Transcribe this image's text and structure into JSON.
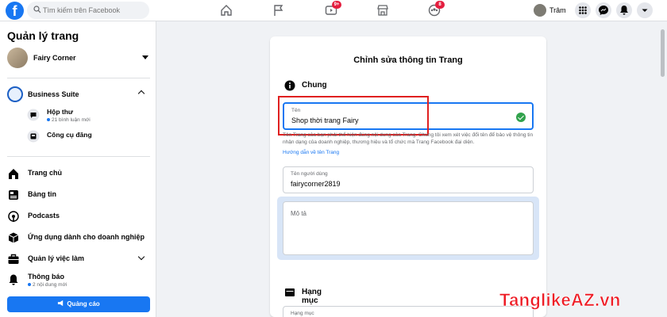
{
  "topbar": {
    "search_placeholder": "Tìm kiếm trên Facebook",
    "video_badge": "9+",
    "groups_badge": "8",
    "user_name": "Trâm"
  },
  "sidebar": {
    "title": "Quản lý trang",
    "page_name": "Fairy Corner",
    "business_suite": "Business Suite",
    "inbox_label": "Hộp thư",
    "inbox_meta": "21 bình luận mới",
    "tools_label": "Công cụ đăng",
    "nav": [
      {
        "label": "Trang chủ"
      },
      {
        "label": "Bảng tin"
      },
      {
        "label": "Podcasts"
      },
      {
        "label": "Ứng dụng dành cho doanh nghiệp"
      },
      {
        "label": "Quản lý việc làm"
      },
      {
        "label": "Thông báo",
        "meta": "2 nội dung mới"
      }
    ],
    "promo_button": "Quảng cáo"
  },
  "card": {
    "title": "Chỉnh sửa thông tin Trang",
    "section_general": "Chung",
    "name_label": "Tên",
    "name_value": "Shop thời trang Fairy",
    "helper_text": "Tên Trang của bạn phải thể hiện đúng nội dung của Trang. Chúng tôi xem xét việc đổi tên để bảo vệ thông tin nhận dạng của doanh nghiệp, thương hiệu và tổ chức mà Trang Facebook đại diện.",
    "helper_link": "Hướng dẫn về tên Trang",
    "username_label": "Tên người dùng",
    "username_value": "fairycorner2819",
    "description_placeholder": "Mô tả",
    "section_category": "Hạng mục",
    "category_label": "Hạng mục"
  },
  "watermark": "TanglikeAZ.vn",
  "colors": {
    "accent": "#1877f2",
    "highlight_box": "#e02020",
    "watermark": "#ee1c25",
    "success": "#31a24c"
  }
}
